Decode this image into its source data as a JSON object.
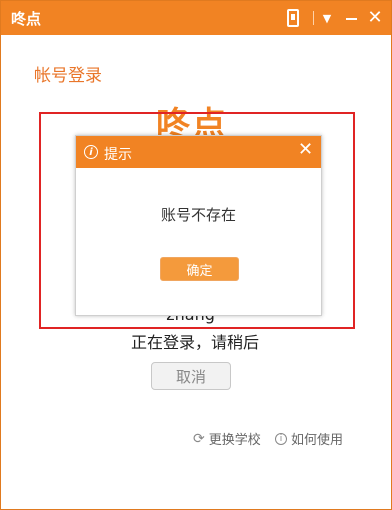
{
  "app": {
    "title": "咚点"
  },
  "titlebar": {
    "icons": [
      "phone-icon",
      "dropdown-icon",
      "minimize-icon",
      "close-icon"
    ],
    "close_glyph": "✕",
    "menu_glyph": "▼"
  },
  "login": {
    "heading": "帐号登录",
    "logo_text": "咚点",
    "username_partial": "   zhang",
    "status": "正在登录，请稍后",
    "cancel_label": "取消"
  },
  "footer": {
    "switch_school": "更换学校",
    "how_to_use": "如何使用"
  },
  "dialog": {
    "title": "提示",
    "info_glyph": "i",
    "close_glyph": "✕",
    "message": "账号不存在",
    "ok_label": "确定"
  },
  "colors": {
    "brand_orange": "#f18323",
    "highlight_red": "#e02424"
  }
}
